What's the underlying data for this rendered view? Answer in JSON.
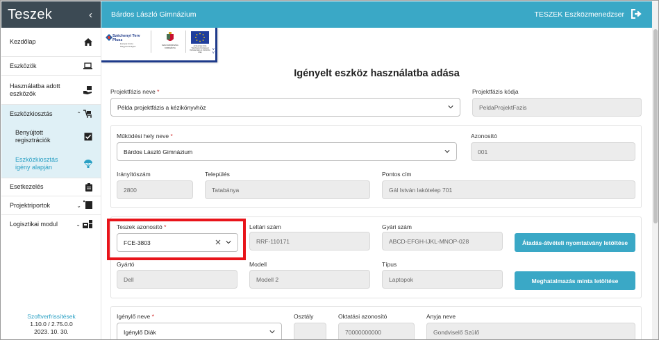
{
  "sidebar": {
    "title": "Teszek",
    "items": [
      {
        "label": "Kezdőlap",
        "icon": "home-icon"
      },
      {
        "label": "Eszközök",
        "icon": "laptop-icon"
      },
      {
        "label": "Használatba adott eszközök",
        "icon": "hand-device-icon"
      },
      {
        "label": "Eszközkiosztás",
        "icon": "cart-icon",
        "expanded": true
      },
      {
        "label": "Benyújtott regisztrációk",
        "icon": "checkbox-icon"
      },
      {
        "label": "Eszközkiosztás igény alapján",
        "icon": "parachute-icon",
        "current": true
      },
      {
        "label": "Esetkezelés",
        "icon": "clipboard-icon"
      },
      {
        "label": "Projektriportok",
        "icon": "report-icon"
      },
      {
        "label": "Logisztikai modul",
        "icon": "logistics-icon"
      }
    ],
    "footer": {
      "link": "Szoftverfrissítések",
      "version": "1.10.0 / 2.75.0.0",
      "date": "2023. 10. 30."
    }
  },
  "topbar": {
    "school": "Bárdos László Gimnázium",
    "app_name": "TESZEK Eszközmenedzser",
    "logout_icon": "logout-icon"
  },
  "logos": {
    "szechenyi": "Széchenyi Terv Plusz",
    "szechenyi_sub": "Európai Uniós Magyarországért",
    "gov": "MAGYARORSZÁG KORMÁNYA",
    "eu": "Az Európai Unió Társfinanszírozásával Kártalanítási és Kohéziós Alap"
  },
  "page": {
    "title": "Igényelt eszköz használatba adása"
  },
  "form": {
    "projektfazis_label": "Projektfázis neve",
    "projektfazis_value": "Példa projektfázis a kézikönyvhöz",
    "projektfazis_kod_label": "Projektfázis kódja",
    "projektfazis_kod_value": "PeldaProjektFazis",
    "mukodesi_label": "Működési hely neve",
    "mukodesi_value": "Bárdos László Gimnázium",
    "azonosito_label": "Azonosító",
    "azonosito_value": "001",
    "iranyitoszam_label": "Irányítószám",
    "iranyitoszam_value": "2800",
    "telepules_label": "Település",
    "telepules_value": "Tatabánya",
    "pontos_cim_label": "Pontos cím",
    "pontos_cim_value": "Gál István lakótelep 701",
    "teszek_label": "Teszek azonosító",
    "teszek_value": "FCE-3803",
    "leltari_label": "Leltári szám",
    "leltari_value": "RRF-110171",
    "gyari_label": "Gyári szám",
    "gyari_value": "ABCD-EFGH-IJKL-MNOP-028",
    "gyarto_label": "Gyártó",
    "gyarto_value": "Dell",
    "modell_label": "Modell",
    "modell_value": "Modell 2",
    "tipus_label": "Típus",
    "tipus_value": "Laptopok",
    "btn_atadas": "Átadás-átvételi nyomtatvány letöltése",
    "btn_meghatalmazas": "Meghatalmazás minta letöltése",
    "igenylo_label": "Igénylő neve",
    "igenylo_value": "Igénylő Diák",
    "osztaly_label": "Osztály",
    "osztaly_value": "",
    "oktatasi_label": "Oktatási azonosító",
    "oktatasi_value": "70000000000",
    "anyja_label": "Anyja neve",
    "anyja_value": "Gondviselő Szülő",
    "required_mark": "*"
  },
  "colors": {
    "sidebar_header": "#3c4a54",
    "topbar": "#3aa8c6",
    "accent": "#3aa8c6",
    "highlight": "#e8141a",
    "active_bg": "#dff0f6"
  }
}
